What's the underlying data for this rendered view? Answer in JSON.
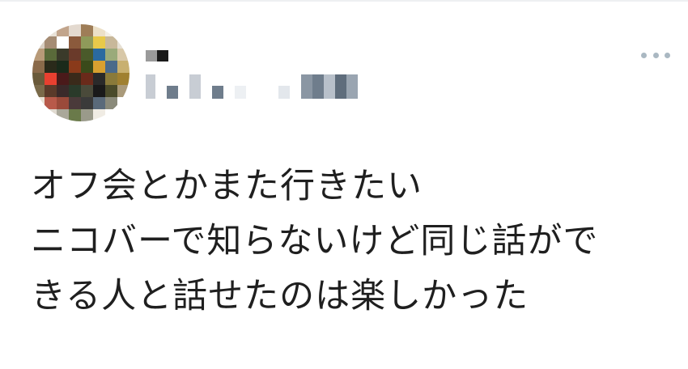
{
  "tweet": {
    "lines": [
      "オフ会とかまた行きたい",
      "ニコバーで知らないけど同じ話ができる人と話せたのは楽しかった"
    ],
    "line2_part1": "ニコバーで知らないけど同じ話がで",
    "line2_part2": "きる人と話せたのは楽しかった"
  },
  "author": {
    "avatar_icon": "pixelated-avatar-icon",
    "name_redacted": true,
    "handle_redacted": true
  },
  "actions": {
    "more_icon": "more-dots-icon"
  },
  "colors": {
    "text": "#1f1f1f",
    "icon_gray": "#aab8c2",
    "background": "#ffffff"
  }
}
